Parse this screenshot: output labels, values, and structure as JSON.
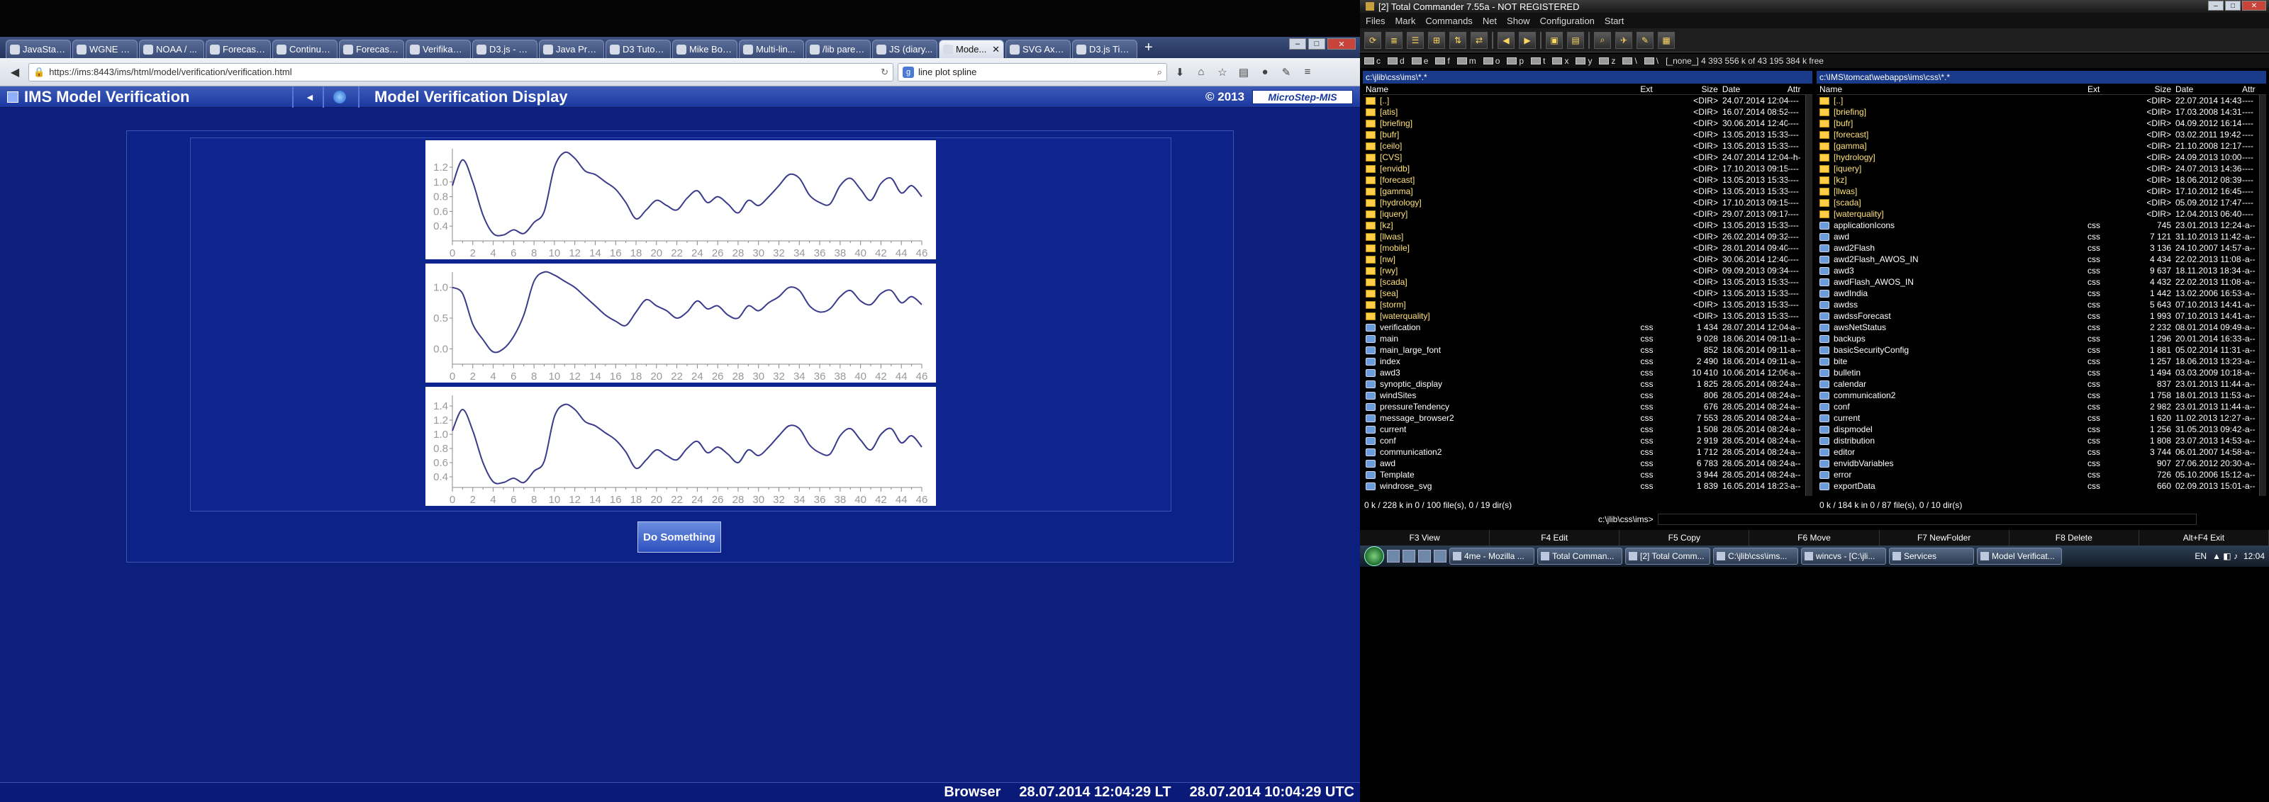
{
  "browser": {
    "tabs": [
      {
        "label": "JavaStat -- 2-...",
        "active": false
      },
      {
        "label": "WGNE as...",
        "active": false
      },
      {
        "label": "NOAA / ...",
        "active": false
      },
      {
        "label": "Forecast ...",
        "active": false
      },
      {
        "label": "Continuo...",
        "active": false
      },
      {
        "label": "Forecast-...",
        "active": false
      },
      {
        "label": "Verifikacie - ...",
        "active": false
      },
      {
        "label": "D3.js - Data-D...",
        "active": false
      },
      {
        "label": "Java Prac...",
        "active": false
      },
      {
        "label": "D3 Tutorial T...",
        "active": false
      },
      {
        "label": "Mike Bostock",
        "active": false
      },
      {
        "label": "Multi-lin...",
        "active": false
      },
      {
        "label": "/lib paren...",
        "active": false
      },
      {
        "label": "JS (diary...",
        "active": false
      },
      {
        "label": "Mode...",
        "active": true
      },
      {
        "label": "SVG Axes ...",
        "active": false
      },
      {
        "label": "D3.js Tips...",
        "active": false
      }
    ],
    "url": "https://ims:8443/ims/html/model/verification/verification.html",
    "search_value": "line plot spline"
  },
  "ims": {
    "app_title": "IMS  Model Verification",
    "page_title": "Model Verification Display",
    "copyright": "© 2013",
    "brand": "MicroStep-MIS",
    "button_label": "Do Something",
    "status": {
      "label": "Browser",
      "local_time": "28.07.2014 12:04:29 LT",
      "utc_time": "28.07.2014 10:04:29 UTC"
    }
  },
  "chart_data": [
    {
      "type": "line",
      "x_ticks": [
        0,
        2,
        4,
        6,
        8,
        10,
        12,
        14,
        16,
        18,
        20,
        22,
        24,
        26,
        28,
        30,
        32,
        34,
        36,
        38,
        40,
        42,
        44,
        46
      ],
      "y_ticks": [
        "1.2",
        "1.0",
        "0.8",
        "0.6",
        "0.4"
      ],
      "ylim": [
        0.2,
        1.45
      ],
      "series": [
        {
          "values": [
            0.95,
            1.3,
            1.0,
            0.55,
            0.3,
            0.28,
            0.35,
            0.3,
            0.45,
            0.6,
            1.2,
            1.4,
            1.32,
            1.15,
            1.1,
            1.0,
            0.9,
            0.72,
            0.5,
            0.62,
            0.75,
            0.68,
            0.62,
            0.78,
            0.88,
            0.72,
            0.8,
            0.7,
            0.58,
            0.75,
            0.68,
            0.8,
            0.95,
            1.1,
            1.05,
            0.82,
            0.72,
            0.7,
            0.95,
            1.05,
            0.9,
            0.75,
            0.98,
            1.05,
            0.85,
            0.95,
            0.8
          ]
        }
      ]
    },
    {
      "type": "line",
      "x_ticks": [
        0,
        2,
        4,
        6,
        8,
        10,
        12,
        14,
        16,
        18,
        20,
        22,
        24,
        26,
        28,
        30,
        32,
        34,
        36,
        38,
        40,
        42,
        44,
        46
      ],
      "y_ticks": [
        "0.0",
        "0.5",
        "1.0"
      ],
      "ylim": [
        -0.25,
        1.25
      ],
      "series": [
        {
          "values": [
            1.0,
            0.9,
            0.4,
            0.15,
            -0.05,
            0.0,
            0.2,
            0.55,
            1.1,
            1.25,
            1.2,
            1.1,
            1.0,
            0.85,
            0.7,
            0.55,
            0.45,
            0.38,
            0.6,
            0.8,
            0.7,
            0.62,
            0.5,
            0.6,
            0.78,
            0.65,
            0.7,
            0.55,
            0.5,
            0.7,
            0.62,
            0.75,
            0.85,
            1.0,
            0.95,
            0.7,
            0.6,
            0.65,
            0.85,
            0.95,
            0.78,
            0.72,
            0.9,
            0.95,
            0.75,
            0.85,
            0.72
          ]
        }
      ]
    },
    {
      "type": "line",
      "x_ticks": [
        0,
        2,
        4,
        6,
        8,
        10,
        12,
        14,
        16,
        18,
        20,
        22,
        24,
        26,
        28,
        30,
        32,
        34,
        36,
        38,
        40,
        42,
        44,
        46
      ],
      "y_ticks": [
        "1.4",
        "1.2",
        "1.0",
        "0.8",
        "0.6",
        "0.4"
      ],
      "ylim": [
        0.25,
        1.55
      ],
      "series": [
        {
          "values": [
            1.05,
            1.35,
            1.05,
            0.6,
            0.33,
            0.32,
            0.38,
            0.32,
            0.48,
            0.62,
            1.25,
            1.42,
            1.35,
            1.18,
            1.12,
            1.02,
            0.92,
            0.75,
            0.52,
            0.64,
            0.78,
            0.7,
            0.64,
            0.8,
            0.9,
            0.74,
            0.82,
            0.72,
            0.6,
            0.78,
            0.7,
            0.82,
            0.98,
            1.12,
            1.08,
            0.85,
            0.74,
            0.72,
            0.98,
            1.08,
            0.92,
            0.78,
            1.0,
            1.08,
            0.88,
            0.98,
            0.82
          ]
        }
      ]
    }
  ],
  "tc": {
    "title": "[2] Total Commander 7.55a - NOT REGISTERED",
    "menu": [
      "Files",
      "Mark",
      "Commands",
      "Net",
      "Show",
      "Configuration",
      "Start"
    ],
    "drives": [
      "c",
      "d",
      "e",
      "f",
      "m",
      "o",
      "p",
      "t",
      "x",
      "y",
      "z",
      "\\",
      "\\"
    ],
    "drive_info": "[_none_]  4 393 556 k of 43 195 384 k free",
    "left_path": "c:\\jlib\\css\\ims\\*.*",
    "right_path": "c:\\IMS\\tomcat\\webapps\\ims\\css\\*.*",
    "col_headers": {
      "name": "Name",
      "ext": "Ext",
      "size": "Size",
      "date": "Date",
      "attr": "Attr"
    },
    "left_rows": [
      [
        "[..]",
        "",
        "<DIR>",
        "24.07.2014 12:04",
        "----",
        "dir"
      ],
      [
        "[atis]",
        "",
        "<DIR>",
        "16.07.2014 08:52",
        "----",
        "dir"
      ],
      [
        "[briefing]",
        "",
        "<DIR>",
        "30.06.2014 12:40",
        "----",
        "dir"
      ],
      [
        "[bufr]",
        "",
        "<DIR>",
        "13.05.2013 15:33",
        "----",
        "dir"
      ],
      [
        "[ceilo]",
        "",
        "<DIR>",
        "13.05.2013 15:33",
        "----",
        "dir"
      ],
      [
        "[CVS]",
        "",
        "<DIR>",
        "24.07.2014 12:04",
        "--h-",
        "dir"
      ],
      [
        "[envidb]",
        "",
        "<DIR>",
        "17.10.2013 09:15",
        "----",
        "dir"
      ],
      [
        "[forecast]",
        "",
        "<DIR>",
        "13.05.2013 15:33",
        "----",
        "dir"
      ],
      [
        "[gamma]",
        "",
        "<DIR>",
        "13.05.2013 15:33",
        "----",
        "dir"
      ],
      [
        "[hydrology]",
        "",
        "<DIR>",
        "17.10.2013 09:15",
        "----",
        "dir"
      ],
      [
        "[iquery]",
        "",
        "<DIR>",
        "29.07.2013 09:17",
        "----",
        "dir"
      ],
      [
        "[kz]",
        "",
        "<DIR>",
        "13.05.2013 15:33",
        "----",
        "dir"
      ],
      [
        "[llwas]",
        "",
        "<DIR>",
        "26.02.2014 09:32",
        "----",
        "dir"
      ],
      [
        "[mobile]",
        "",
        "<DIR>",
        "28.01.2014 09:40",
        "----",
        "dir"
      ],
      [
        "[nw]",
        "",
        "<DIR>",
        "30.06.2014 12:40",
        "----",
        "dir"
      ],
      [
        "[rwy]",
        "",
        "<DIR>",
        "09.09.2013 09:34",
        "----",
        "dir"
      ],
      [
        "[scada]",
        "",
        "<DIR>",
        "13.05.2013 15:33",
        "----",
        "dir"
      ],
      [
        "[sea]",
        "",
        "<DIR>",
        "13.05.2013 15:33",
        "----",
        "dir"
      ],
      [
        "[storm]",
        "",
        "<DIR>",
        "13.05.2013 15:33",
        "----",
        "dir"
      ],
      [
        "[waterquality]",
        "",
        "<DIR>",
        "13.05.2013 15:33",
        "----",
        "dir"
      ],
      [
        "verification",
        "css",
        "1 434",
        "28.07.2014 12:04",
        "-a--",
        "file"
      ],
      [
        "main",
        "css",
        "9 028",
        "18.06.2014 09:11",
        "-a--",
        "file"
      ],
      [
        "main_large_font",
        "css",
        "852",
        "18.06.2014 09:11",
        "-a--",
        "file"
      ],
      [
        "index",
        "css",
        "2 490",
        "18.06.2014 09:11",
        "-a--",
        "file"
      ],
      [
        "awd3",
        "css",
        "10 410",
        "10.06.2014 12:06",
        "-a--",
        "file"
      ],
      [
        "synoptic_display",
        "css",
        "1 825",
        "28.05.2014 08:24",
        "-a--",
        "file"
      ],
      [
        "windSites",
        "css",
        "806",
        "28.05.2014 08:24",
        "-a--",
        "file"
      ],
      [
        "pressureTendency",
        "css",
        "676",
        "28.05.2014 08:24",
        "-a--",
        "file"
      ],
      [
        "message_browser2",
        "css",
        "7 553",
        "28.05.2014 08:24",
        "-a--",
        "file"
      ],
      [
        "current",
        "css",
        "1 508",
        "28.05.2014 08:24",
        "-a--",
        "file"
      ],
      [
        "conf",
        "css",
        "2 919",
        "28.05.2014 08:24",
        "-a--",
        "file"
      ],
      [
        "communication2",
        "css",
        "1 712",
        "28.05.2014 08:24",
        "-a--",
        "file"
      ],
      [
        "awd",
        "css",
        "6 783",
        "28.05.2014 08:24",
        "-a--",
        "file"
      ],
      [
        "Template",
        "css",
        "3 944",
        "28.05.2014 08:24",
        "-a--",
        "file"
      ],
      [
        "windrose_svg",
        "css",
        "1 839",
        "16.05.2014 18:23",
        "-a--",
        "file"
      ]
    ],
    "right_rows": [
      [
        "[..]",
        "",
        "<DIR>",
        "22.07.2014 14:43",
        "----",
        "dir"
      ],
      [
        "[briefing]",
        "",
        "<DIR>",
        "17.03.2008 14:31",
        "----",
        "dir"
      ],
      [
        "[bufr]",
        "",
        "<DIR>",
        "04.09.2012 16:14",
        "----",
        "dir"
      ],
      [
        "[forecast]",
        "",
        "<DIR>",
        "03.02.2011 19:42",
        "----",
        "dir"
      ],
      [
        "[gamma]",
        "",
        "<DIR>",
        "21.10.2008 12:17",
        "----",
        "dir"
      ],
      [
        "[hydrology]",
        "",
        "<DIR>",
        "24.09.2013 10:00",
        "----",
        "dir"
      ],
      [
        "[iquery]",
        "",
        "<DIR>",
        "24.07.2013 14:36",
        "----",
        "dir"
      ],
      [
        "[kz]",
        "",
        "<DIR>",
        "18.06.2012 08:39",
        "----",
        "dir"
      ],
      [
        "[llwas]",
        "",
        "<DIR>",
        "17.10.2012 16:45",
        "----",
        "dir"
      ],
      [
        "[scada]",
        "",
        "<DIR>",
        "05.09.2012 17:47",
        "----",
        "dir"
      ],
      [
        "[waterquality]",
        "",
        "<DIR>",
        "12.04.2013 06:40",
        "----",
        "dir"
      ],
      [
        "applicationIcons",
        "css",
        "745",
        "23.01.2013 12:24",
        "-a--",
        "file"
      ],
      [
        "awd",
        "css",
        "7 121",
        "31.10.2013 11:42",
        "-a--",
        "file"
      ],
      [
        "awd2Flash",
        "css",
        "3 136",
        "24.10.2007 14:57",
        "-a--",
        "file"
      ],
      [
        "awd2Flash_AWOS_IN",
        "css",
        "4 434",
        "22.02.2013 11:08",
        "-a--",
        "file"
      ],
      [
        "awd3",
        "css",
        "9 637",
        "18.11.2013 18:34",
        "-a--",
        "file"
      ],
      [
        "awdFlash_AWOS_IN",
        "css",
        "4 432",
        "22.02.2013 11:08",
        "-a--",
        "file"
      ],
      [
        "awdIndia",
        "css",
        "1 442",
        "13.02.2006 16:53",
        "-a--",
        "file"
      ],
      [
        "awdss",
        "css",
        "5 643",
        "07.10.2013 14:41",
        "-a--",
        "file"
      ],
      [
        "awdssForecast",
        "css",
        "1 993",
        "07.10.2013 14:41",
        "-a--",
        "file"
      ],
      [
        "awsNetStatus",
        "css",
        "2 232",
        "08.01.2014 09:49",
        "-a--",
        "file"
      ],
      [
        "backups",
        "css",
        "1 296",
        "20.01.2014 16:33",
        "-a--",
        "file"
      ],
      [
        "basicSecurityConfig",
        "css",
        "1 881",
        "05.02.2014 11:31",
        "-a--",
        "file"
      ],
      [
        "bite",
        "css",
        "1 257",
        "18.06.2013 13:23",
        "-a--",
        "file"
      ],
      [
        "bulletin",
        "css",
        "1 494",
        "03.03.2009 10:18",
        "-a--",
        "file"
      ],
      [
        "calendar",
        "css",
        "837",
        "23.01.2013 11:44",
        "-a--",
        "file"
      ],
      [
        "communication2",
        "css",
        "1 758",
        "18.01.2013 11:53",
        "-a--",
        "file"
      ],
      [
        "conf",
        "css",
        "2 982",
        "23.01.2013 11:44",
        "-a--",
        "file"
      ],
      [
        "current",
        "css",
        "1 620",
        "11.02.2013 12:27",
        "-a--",
        "file"
      ],
      [
        "dispmodel",
        "css",
        "1 256",
        "31.05.2013 09:42",
        "-a--",
        "file"
      ],
      [
        "distribution",
        "css",
        "1 808",
        "23.07.2013 14:53",
        "-a--",
        "file"
      ],
      [
        "editor",
        "css",
        "3 744",
        "06.01.2007 14:58",
        "-a--",
        "file"
      ],
      [
        "envidbVariables",
        "css",
        "907",
        "27.06.2012 20:30",
        "-a--",
        "file"
      ],
      [
        "error",
        "css",
        "726",
        "05.10.2006 15:12",
        "-a--",
        "file"
      ],
      [
        "exportData",
        "css",
        "660",
        "02.09.2013 15:01",
        "-a--",
        "file"
      ]
    ],
    "left_status": "0 k / 228 k in 0 / 100 file(s), 0 / 19 dir(s)",
    "right_status": "0 k / 184 k in 0 / 87 file(s), 0 / 10 dir(s)",
    "cmd_path": "c:\\jlib\\css\\ims>",
    "fkeys": [
      "F3 View",
      "F4 Edit",
      "F5 Copy",
      "F6 Move",
      "F7 NewFolder",
      "F8 Delete",
      "Alt+F4 Exit"
    ],
    "taskbar": [
      "4me - Mozilla ...",
      "Total Comman...",
      "[2] Total Comm...",
      "C:\\jlib\\css\\ims...",
      "wincvs - [C:\\jli...",
      "Services",
      "Model Verificat..."
    ],
    "tray": {
      "lang": "EN",
      "time": "12:04"
    }
  }
}
